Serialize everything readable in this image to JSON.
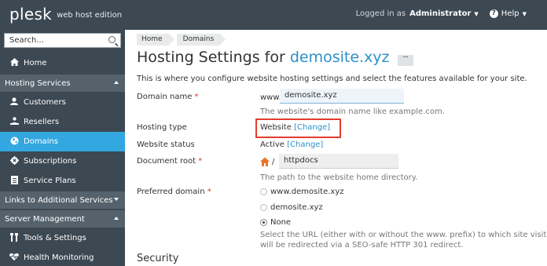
{
  "topbar": {
    "logo": "plesk",
    "edition": "web host edition",
    "logged_in_as": "Logged in as",
    "user": "Administrator",
    "help": "Help"
  },
  "sidebar": {
    "search_placeholder": "Search...",
    "home": "Home",
    "section_hosting": "Hosting Services",
    "customers": "Customers",
    "resellers": "Resellers",
    "domains": "Domains",
    "subscriptions": "Subscriptions",
    "service_plans": "Service Plans",
    "section_links": "Links to Additional Services",
    "section_server": "Server Management",
    "tools_settings": "Tools & Settings",
    "health_monitoring": "Health Monitoring",
    "accent_color": "#33a7e0"
  },
  "breadcrumbs": [
    "Home",
    "Domains"
  ],
  "page": {
    "title_prefix": "Hosting Settings for",
    "title_site": "demosite.xyz",
    "more_label": "···",
    "intro": "This is where you configure website hosting settings and select the features available for your site."
  },
  "form": {
    "domain_name_label": "Domain name",
    "required_mark": "*",
    "www_prefix": "www.",
    "domain_value": "demosite.xyz",
    "domain_hint": "The website's domain name like example.com.",
    "hosting_type_label": "Hosting type",
    "hosting_type_value": "Website",
    "change_link": "[Change]",
    "website_status_label": "Website status",
    "website_status_value": "Active",
    "document_root_label": "Document root",
    "docroot_sep": "/",
    "docroot_value": "httpdocs",
    "docroot_hint": "The path to the website home directory.",
    "preferred_domain_label": "Preferred domain",
    "preferred_options": [
      "www.demosite.xyz",
      "demosite.xyz",
      "None"
    ],
    "preferred_selected": "None",
    "preferred_hint_1": "Select the URL (either with or without the www. prefix) to which site visitors",
    "preferred_hint_2": "will be redirected via a SEO-safe HTTP 301 redirect.",
    "security_heading": "Security",
    "highlight_color": "#e23d2f"
  }
}
